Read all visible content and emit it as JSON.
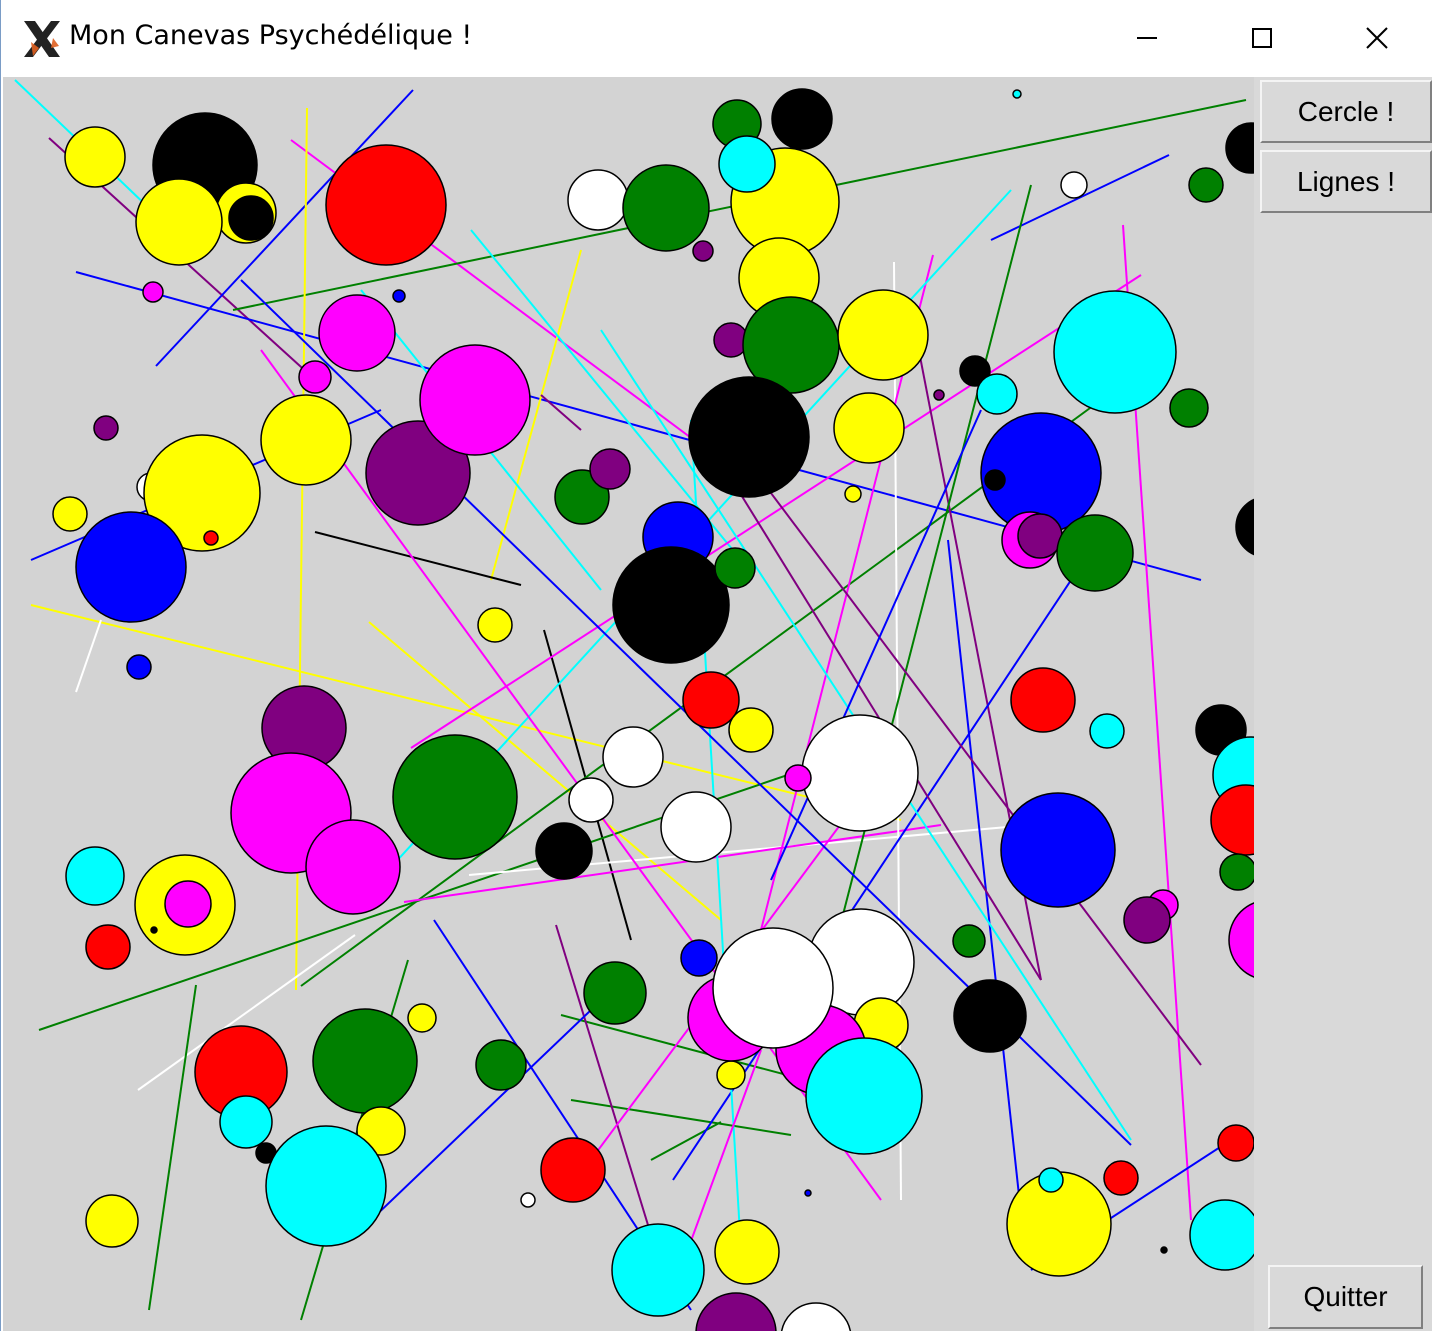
{
  "window": {
    "title": "Mon Canevas Psychédélique !"
  },
  "buttons": {
    "cercle": "Cercle !",
    "lignes": "Lignes !",
    "quitter": "Quitter"
  },
  "colors": {
    "canvas_bg": "#d3d3d3",
    "panel_bg": "#d9d9d9",
    "palette": [
      "black",
      "white",
      "red",
      "green",
      "blue",
      "cyan",
      "yellow",
      "magenta",
      "purple"
    ]
  },
  "icons": {
    "app": "x-app-icon",
    "minimize": "minimize-icon",
    "maximize": "maximize-icon",
    "close": "close-icon"
  }
}
